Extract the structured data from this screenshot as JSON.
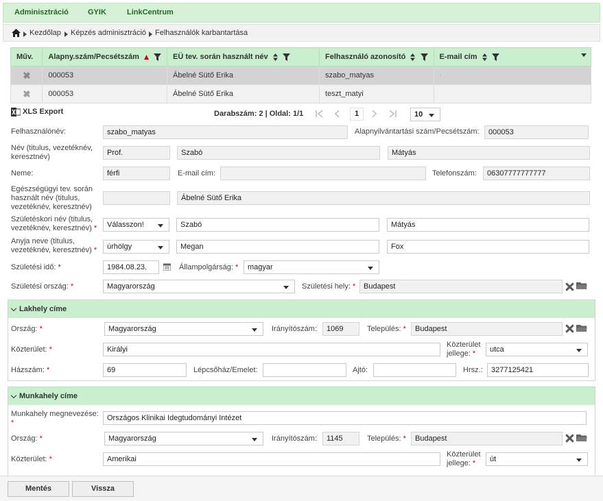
{
  "topnav": [
    "Adminisztráció",
    "GYIK",
    "LinkCentrum"
  ],
  "breadcrumb": [
    "Kezdőlap",
    "Képzés adminisztráció",
    "Felhasználók karbantartása"
  ],
  "grid": {
    "columns": [
      "Műv.",
      "Alapny.szám/Pecsétszám",
      "EÜ tev. során használt név",
      "Felhasználó azonosító",
      "E-mail cím"
    ],
    "rows": [
      [
        "000053",
        "Ábelné Sütő Erika",
        "szabo_matyas",
        "·"
      ],
      [
        "000053",
        "Ábelné Sütő Erika",
        "teszt_matyi",
        ""
      ]
    ]
  },
  "toolbar": {
    "xls_export": "XLS Export",
    "count_text": "Darabszám: 2 | Oldal: 1/1",
    "current_page": "1",
    "page_size": "10"
  },
  "form": {
    "username_label": "Felhasználónév:",
    "username": "szabo_matyas",
    "reg_label": "Alapnyilvántartási szám/Pecsétszám:",
    "reg_number": "000053",
    "name_label": "Név (titulus, vezetéknév, keresztnév)",
    "title": "Prof.",
    "last_name": "Szabó",
    "first_name": "Mátyás",
    "gender_label": "Neme:",
    "gender": "férfi",
    "email_label": "E-mail cím:",
    "email": "",
    "phone_label": "Telefonszám:",
    "phone": "06307777777777",
    "health_name_label": "Egészségügyi tev. során használt név (titulus, vezetéknév, keresztnév)",
    "health_title": "",
    "health_name": "Ábelné Sütő Erika",
    "birth_name_label": "Születéskori név (titulus, vezetéknév, keresztnév)",
    "birth_title": "Válasszon!",
    "birth_last": "Szabó",
    "birth_first": "Mátyás",
    "mother_label": "Anyja neve (titulus, vezetéknév, keresztnév)",
    "mother_title": "úrhölgy",
    "mother_last": "Megan",
    "mother_first": "Fox",
    "birth_date_label": "Születési idő:",
    "birth_date": "1984.08.23.",
    "citizenship_label": "Állampolgárság:",
    "citizenship": "magyar",
    "birth_country_label": "Születési ország:",
    "birth_country": "Magyarország",
    "birth_place_label": "Születési hely:",
    "birth_place": "Budapest"
  },
  "residence": {
    "title": "Lakhely címe",
    "country_label": "Ország:",
    "country": "Magyarország",
    "zip_label": "Irányítószám:",
    "zip": "1069",
    "city_label": "Település:",
    "city": "Budapest",
    "street_label": "Közterület:",
    "street": "Királyi",
    "street_type_label": "Közterület jellege:",
    "street_type": "utca",
    "house_label": "Házszám:",
    "house": "69",
    "stair_label": "Lépcsőház/Emelet:",
    "stair": "",
    "door_label": "Ajtó:",
    "door": "",
    "hrsz_label": "Hrsz.:",
    "hrsz": "3277125421"
  },
  "workplace": {
    "title": "Munkahely címe",
    "name_label": "Munkahely megnevezése:",
    "name": "Országos Klinikai Idegtudományi Intézet",
    "country_label": "Ország:",
    "country": "Magyarország",
    "zip_label": "Irányítószám:",
    "zip": "1145",
    "city_label": "Település:",
    "city": "Budapest",
    "street_label": "Közterület:",
    "street": "Amerikai",
    "street_type_label": "Közterület jellege:",
    "street_type": "út"
  },
  "footer": {
    "save": "Mentés",
    "back": "Vissza"
  },
  "colors": {
    "header_green": "#c9efcf",
    "nav_text": "#1f6b1f",
    "required": "#d0021b"
  }
}
